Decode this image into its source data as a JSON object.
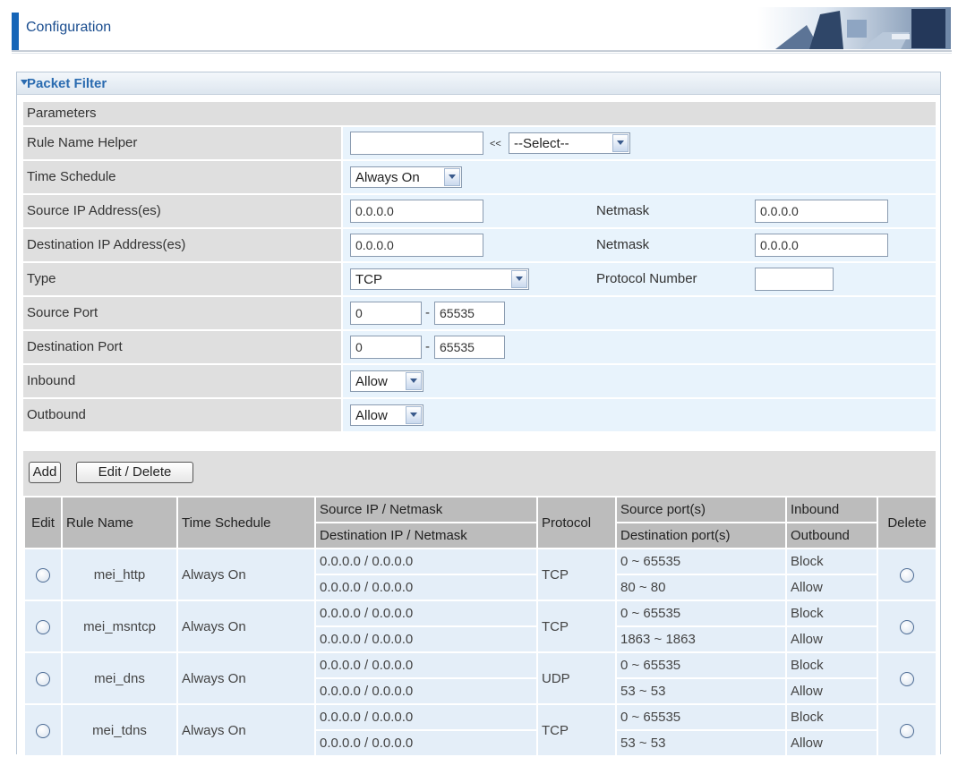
{
  "header": {
    "title": "Configuration"
  },
  "panel": {
    "title": "Packet Filter",
    "section": "Parameters"
  },
  "form": {
    "rule_name": {
      "label": "Rule Name  Helper",
      "value": "",
      "separator": "<<",
      "select_value": "--Select--"
    },
    "time_schedule": {
      "label": "Time Schedule",
      "value": "Always On"
    },
    "source_ip": {
      "label": "Source IP Address(es)",
      "value": "0.0.0.0",
      "netmask_label": "Netmask",
      "netmask_value": "0.0.0.0"
    },
    "destination_ip": {
      "label": "Destination IP Address(es)",
      "value": "0.0.0.0",
      "netmask_label": "Netmask",
      "netmask_value": "0.0.0.0"
    },
    "type": {
      "label": "Type",
      "value": "TCP",
      "protocol_label": "Protocol Number",
      "protocol_value": ""
    },
    "source_port": {
      "label": "Source Port",
      "from": "0",
      "dash": "-",
      "to": "65535"
    },
    "destination_port": {
      "label": "Destination Port",
      "from": "0",
      "dash": "-",
      "to": "65535"
    },
    "inbound": {
      "label": "Inbound",
      "value": "Allow"
    },
    "outbound": {
      "label": "Outbound",
      "value": "Allow"
    }
  },
  "buttons": {
    "add": "Add",
    "edit_delete": "Edit / Delete"
  },
  "table": {
    "headers": {
      "edit": "Edit",
      "rule_name": "Rule Name",
      "time_schedule": "Time Schedule",
      "source_ip": "Source IP / Netmask",
      "destination_ip": "Destination IP / Netmask",
      "protocol": "Protocol",
      "source_ports": "Source port(s)",
      "destination_ports": "Destination port(s)",
      "inbound": "Inbound",
      "outbound": "Outbound",
      "delete": "Delete"
    },
    "rows": [
      {
        "name": "mei_http",
        "schedule": "Always On",
        "src_ip": "0.0.0.0 / 0.0.0.0",
        "dst_ip": "0.0.0.0 / 0.0.0.0",
        "protocol": "TCP",
        "src_port": "0 ~ 65535",
        "dst_port": "80 ~ 80",
        "inbound": "Block",
        "outbound": "Allow"
      },
      {
        "name": "mei_msntcp",
        "schedule": "Always On",
        "src_ip": "0.0.0.0 / 0.0.0.0",
        "dst_ip": "0.0.0.0 / 0.0.0.0",
        "protocol": "TCP",
        "src_port": "0 ~ 65535",
        "dst_port": "1863 ~ 1863",
        "inbound": "Block",
        "outbound": "Allow"
      },
      {
        "name": "mei_dns",
        "schedule": "Always On",
        "src_ip": "0.0.0.0 / 0.0.0.0",
        "dst_ip": "0.0.0.0 / 0.0.0.0",
        "protocol": "UDP",
        "src_port": "0 ~ 65535",
        "dst_port": "53 ~ 53",
        "inbound": "Block",
        "outbound": "Allow"
      },
      {
        "name": "mei_tdns",
        "schedule": "Always On",
        "src_ip": "0.0.0.0 / 0.0.0.0",
        "dst_ip": "0.0.0.0 / 0.0.0.0",
        "protocol": "TCP",
        "src_port": "0 ~ 65535",
        "dst_port": "53 ~ 53",
        "inbound": "Block",
        "outbound": "Allow"
      }
    ]
  }
}
